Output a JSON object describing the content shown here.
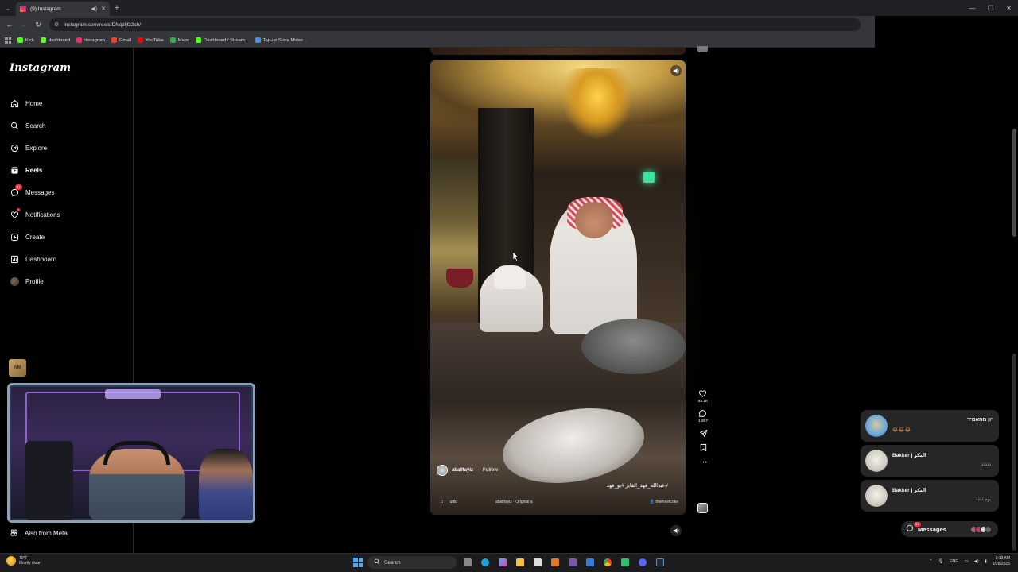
{
  "browser": {
    "tab_title": "(9) Instagram",
    "url": "instagram.com/reels/DNqzljfz2ch/",
    "bookmarks": [
      "Kick",
      "dashboard",
      "instagram",
      "Gmail",
      "YouTube",
      "Maps",
      "Dashboard / Stream...",
      "Top-up Store Midas..."
    ],
    "bookmark_colors": [
      "#53fc18",
      "#53fc18",
      "#e1306c",
      "#ea4335",
      "#ff0000",
      "#34a853",
      "#53fc18",
      "#4a90e2"
    ]
  },
  "sidebar": {
    "logo": "Instagram",
    "items": [
      {
        "label": "Home",
        "icon": "home-icon"
      },
      {
        "label": "Search",
        "icon": "search-icon"
      },
      {
        "label": "Explore",
        "icon": "compass-icon"
      },
      {
        "label": "Reels",
        "icon": "reels-icon",
        "active": true
      },
      {
        "label": "Messages",
        "icon": "messenger-icon",
        "badge": "9+"
      },
      {
        "label": "Notifications",
        "icon": "heart-icon"
      },
      {
        "label": "Create",
        "icon": "plus-square-icon"
      },
      {
        "label": "Dashboard",
        "icon": "chart-icon"
      },
      {
        "label": "Profile",
        "icon": "avatar-icon"
      }
    ],
    "also_from_meta": "Also from Meta"
  },
  "reel": {
    "author": "aballfayiz",
    "follow": "Follow",
    "caption": "#عبدالله_فهد_الفايز #بو_فهد",
    "audio": "udio",
    "audio_source": "aballfayiz · Original a",
    "collaborator": "themeetcoke",
    "likes": "53.1K",
    "comments": "1,907"
  },
  "messages": {
    "previews": [
      {
        "name": "יון מחאמיד",
        "text": "",
        "emoji": "😂😂😂"
      },
      {
        "name": "Bakker | البكر",
        "text": "ذذذذذ",
        "emoji": ""
      },
      {
        "name": "Bakker | البكر",
        "text": "يوم ذذذذ",
        "emoji": ""
      }
    ],
    "pill_label": "Messages",
    "pill_badge": "9+"
  },
  "taskbar": {
    "temp": "70°F",
    "weather": "Mostly clear",
    "search": "Search",
    "lang": "ENG",
    "time": "3:13 AM",
    "date": "8/28/2025"
  },
  "colors": {
    "accent_red": "#ff3040",
    "card_bg": "#262626"
  }
}
